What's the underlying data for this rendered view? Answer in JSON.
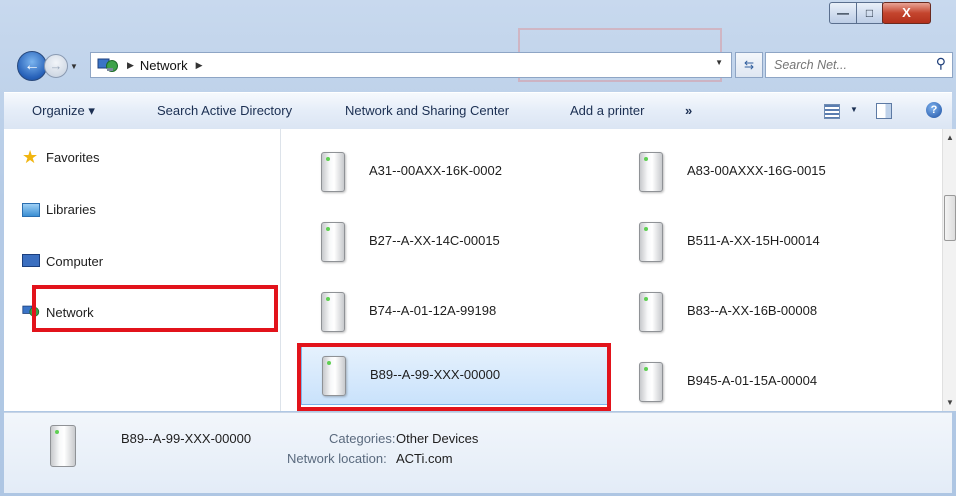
{
  "window": {
    "controls": {
      "minimize": "—",
      "maximize": "□",
      "close": "X"
    }
  },
  "navbar": {
    "back_icon": "back-arrow-icon",
    "forward_icon": "forward-arrow-icon",
    "breadcrumb": [
      "Network"
    ],
    "search_placeholder": "Search Net..."
  },
  "toolbar": {
    "organize": "Organize ▾",
    "search_ad": "Search Active Directory",
    "network_sharing": "Network and Sharing Center",
    "add_printer": "Add a printer",
    "more": "»"
  },
  "sidebar": {
    "items": [
      {
        "label": "Favorites",
        "icon": "star-icon"
      },
      {
        "label": "Libraries",
        "icon": "library-icon"
      },
      {
        "label": "Computer",
        "icon": "computer-icon"
      },
      {
        "label": "Network",
        "icon": "network-icon"
      }
    ]
  },
  "devices": [
    {
      "name": "A31--00AXX-16K-0002"
    },
    {
      "name": "A83-00AXXX-16G-0015"
    },
    {
      "name": "B27--A-XX-14C-00015"
    },
    {
      "name": "B511-A-XX-15H-00014"
    },
    {
      "name": "B74--A-01-12A-99198"
    },
    {
      "name": "B83--A-XX-16B-00008"
    },
    {
      "name": "B89--A-99-XXX-00000"
    },
    {
      "name": "B945-A-01-15A-00004"
    }
  ],
  "details": {
    "name": "B89--A-99-XXX-00000",
    "categories_label": "Categories:",
    "categories_value": "Other Devices",
    "location_label": "Network location:",
    "location_value": "ACTi.com"
  },
  "colors": {
    "highlight": "#e2131b",
    "selection": "#c9e2fb"
  }
}
